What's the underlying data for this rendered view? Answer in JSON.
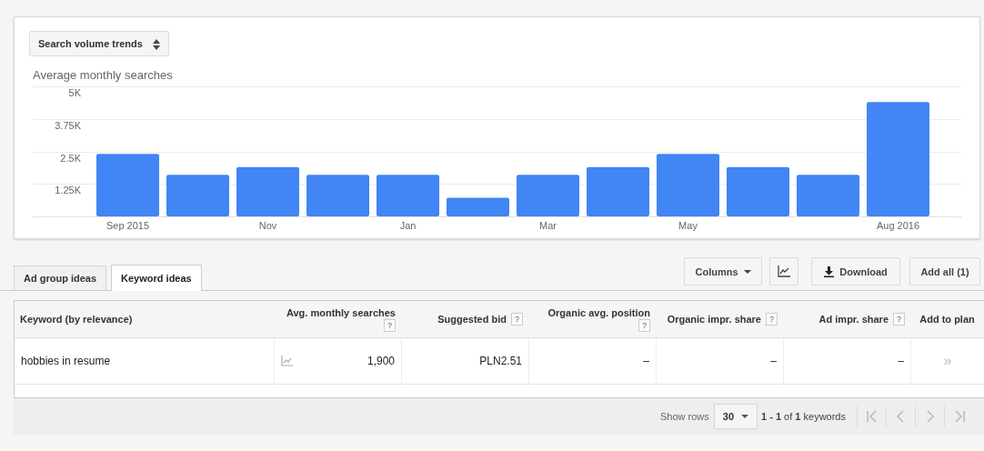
{
  "trend_selector": {
    "label": "Search volume trends"
  },
  "chart": {
    "title": "Average monthly searches",
    "chart_data": {
      "type": "bar",
      "categories": [
        "Sep 2015",
        null,
        "Nov",
        null,
        "Jan",
        null,
        "Mar",
        null,
        "May",
        null,
        null,
        "Aug 2016"
      ],
      "series": [
        {
          "color": "#4285f4",
          "values": [
            2400,
            1600,
            1900,
            1600,
            1600,
            720,
            1600,
            1900,
            2400,
            1900,
            1600,
            4400
          ]
        }
      ],
      "ylim": [
        0,
        5000
      ],
      "yticks": [
        {
          "value": 1250,
          "label": "1.25K"
        },
        {
          "value": 2500,
          "label": "2.5K"
        },
        {
          "value": 3750,
          "label": "3.75K"
        },
        {
          "value": 5000,
          "label": "5K"
        }
      ],
      "grid": true
    }
  },
  "tabs": [
    {
      "label": "Ad group ideas",
      "selected": false
    },
    {
      "label": "Keyword ideas",
      "selected": true
    }
  ],
  "toolbar": {
    "columns_button": "Columns",
    "download_button": "Download",
    "add_all_button": "Add all (1)"
  },
  "table": {
    "columns": [
      {
        "label": "Keyword (by relevance)"
      },
      {
        "label": "Avg. monthly searches",
        "help": "?"
      },
      {
        "label": "Suggested bid",
        "help": "?"
      },
      {
        "label": "Organic avg. position",
        "help": "?"
      },
      {
        "label": "Organic impr. share",
        "help": "?"
      },
      {
        "label": "Ad impr. share",
        "help": "?"
      },
      {
        "label": "Add to plan"
      }
    ],
    "rows": [
      {
        "cells": [
          "hobbies in resume",
          "1,900",
          "PLN2.51",
          "–",
          "–",
          "–",
          "»"
        ]
      }
    ]
  },
  "pagination": {
    "show_rows_label": "Show rows",
    "rows_per_page": "30",
    "summary": "**1 - 1** of **1** keywords"
  }
}
